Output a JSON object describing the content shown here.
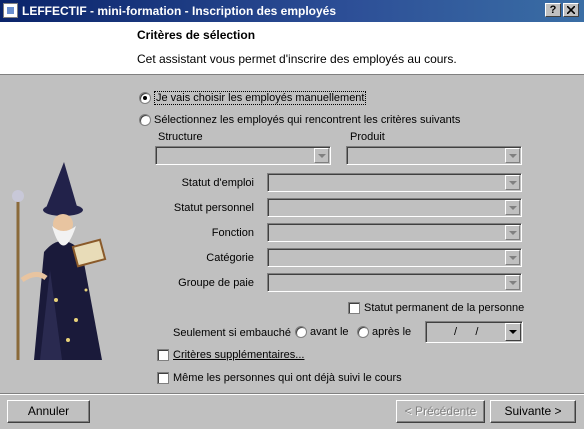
{
  "window": {
    "title": "LEFFECTIF - mini-formation - Inscription des employés",
    "help_label": "?",
    "close_label": "X"
  },
  "header": {
    "title": "Critères de sélection",
    "description": "Cet assistant vous permet d'inscrire des employés au cours."
  },
  "options": {
    "manual_label": "Je vais choisir les employés manuellement",
    "criteria_label": "Sélectionnez les employés qui rencontrent les critères suivants",
    "selected": "manual"
  },
  "criteria": {
    "structure_label": "Structure",
    "produit_label": "Produit",
    "fields": [
      {
        "label": "Statut d'emploi",
        "value": ""
      },
      {
        "label": "Statut personnel",
        "value": ""
      },
      {
        "label": "Fonction",
        "value": ""
      },
      {
        "label": "Catégorie",
        "value": ""
      },
      {
        "label": "Groupe de paie",
        "value": ""
      }
    ],
    "permanent_label": "Statut permanent de la personne",
    "hired_label": "Seulement si embauché",
    "before_label": "avant le",
    "after_label": "après le",
    "date_value": "/      /",
    "extra_criteria_label": "Critères supplémentaires...",
    "already_followed_label": "Même les personnes qui ont déjà suivi le cours"
  },
  "buttons": {
    "cancel": "Annuler",
    "previous": "< Précédente",
    "next": "Suivante >"
  }
}
